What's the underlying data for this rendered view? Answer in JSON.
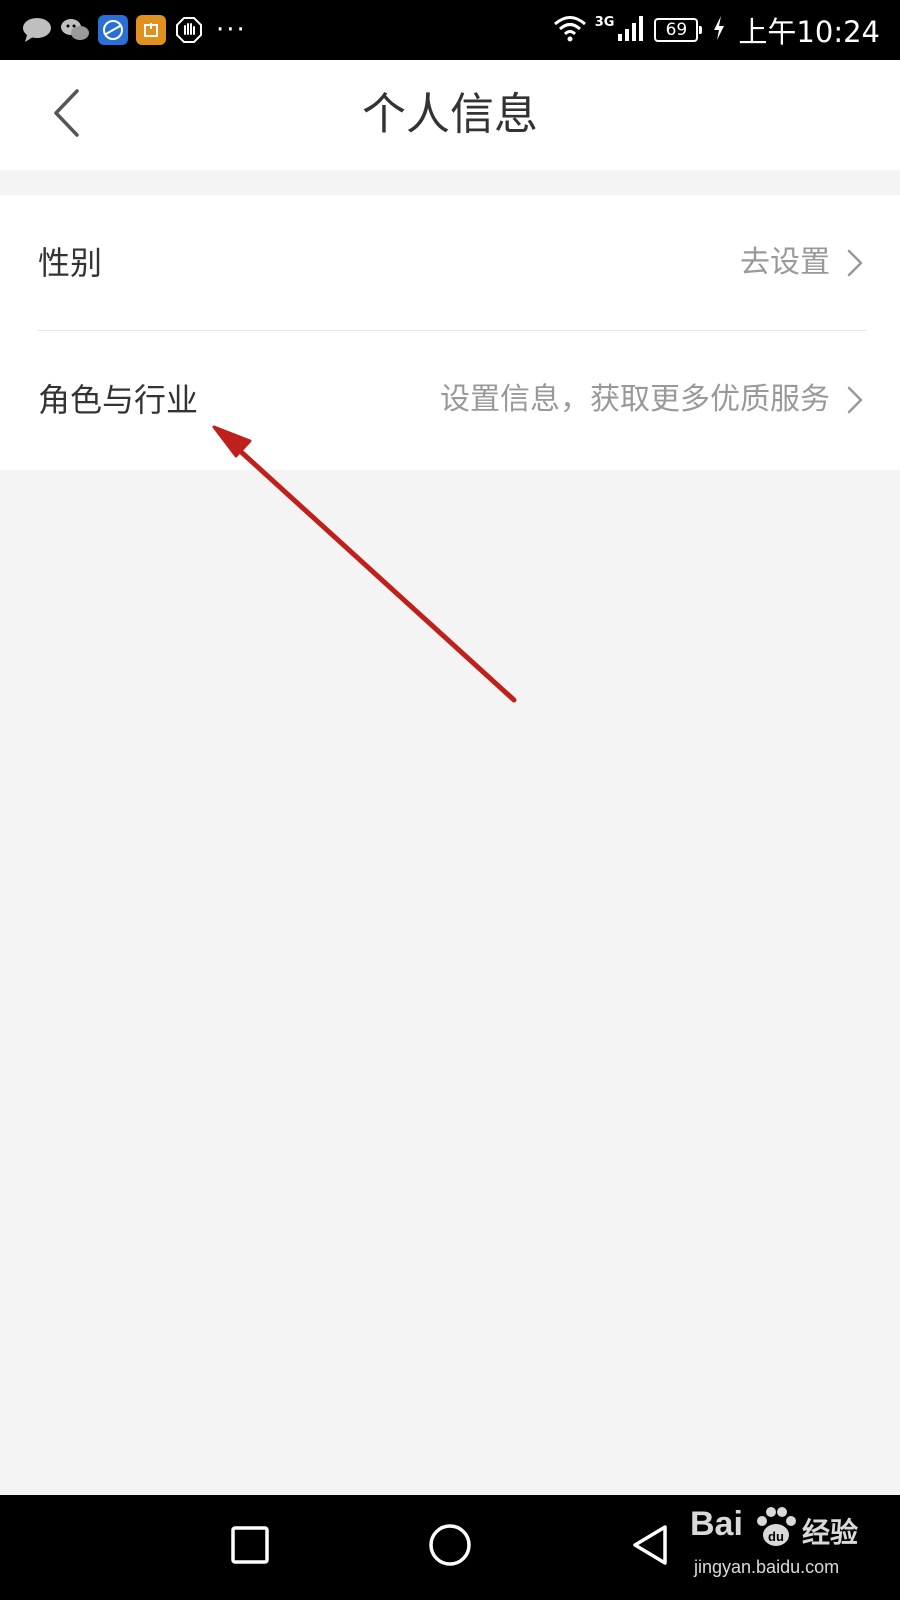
{
  "status_bar": {
    "network_label": "3G",
    "battery_level": "69",
    "time": "上午10:24",
    "notification_icons": [
      "message-icon",
      "wechat-icon",
      "browser-icon",
      "package-icon",
      "hand-icon"
    ],
    "overflow": "···"
  },
  "header": {
    "title": "个人信息",
    "back_icon": "chevron-left-icon"
  },
  "list": {
    "items": [
      {
        "label": "性别",
        "value": "去设置"
      },
      {
        "label": "角色与行业",
        "value": "设置信息，获取更多优质服务"
      }
    ]
  },
  "watermark": {
    "brand": "Bai",
    "brand_cn": "经验",
    "url": "jingyan.baidu.com"
  },
  "colors": {
    "background": "#f4f4f4",
    "card": "#ffffff",
    "primary_text": "#333333",
    "secondary_text": "#999999",
    "annotation_arrow": "#c0201c"
  }
}
